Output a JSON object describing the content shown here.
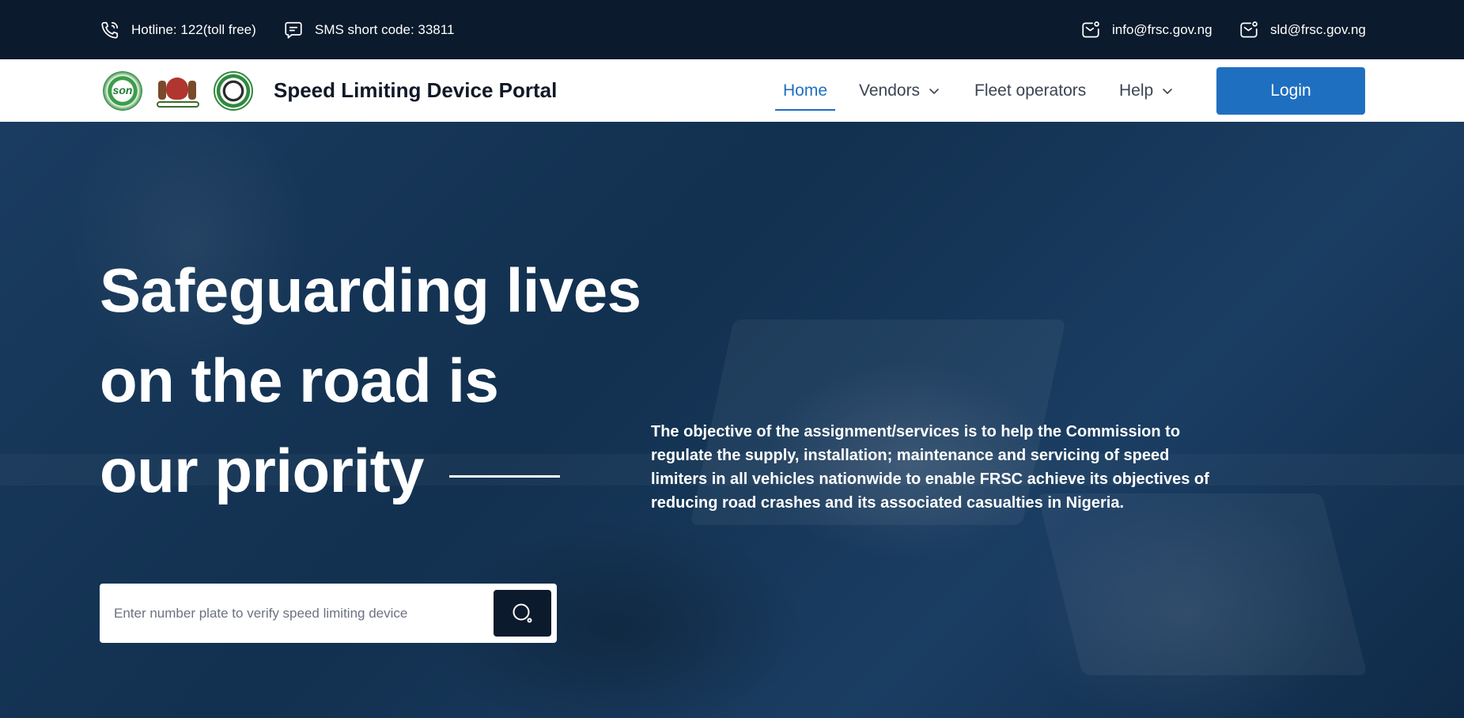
{
  "topbar": {
    "hotline": "Hotline: 122(toll free)",
    "sms": "SMS short code: 33811",
    "email_primary": "info@frsc.gov.ng",
    "email_secondary": "sld@frsc.gov.ng",
    "icons": [
      "phone-icon",
      "chat-icon",
      "mail-icon",
      "mail-icon"
    ]
  },
  "header": {
    "logos": [
      "son-logo",
      "coat-of-arms-logo",
      "gear-logo"
    ],
    "title": "Speed Limiting Device Portal"
  },
  "nav": {
    "home": "Home",
    "vendors": "Vendors",
    "fleet": "Fleet operators",
    "help": "Help",
    "active": "Home",
    "login": "Login"
  },
  "hero": {
    "headline_lines": [
      "Safeguarding lives",
      "on the road is",
      "our priority"
    ],
    "objective": "The objective of the assignment/services is to help the Commission to regulate the supply, installation; maintenance and servicing of speed limiters in all vehicles nationwide to enable FRSC achieve its objectives of reducing road crashes and its associated casualties in Nigeria.",
    "search_placeholder": "Enter number plate to verify speed limiting device"
  },
  "colors": {
    "topbar_bg": "#0b1a2c",
    "accent": "#1f6fc0",
    "hero_overlay": "#12304f",
    "text_dark": "#111827"
  }
}
